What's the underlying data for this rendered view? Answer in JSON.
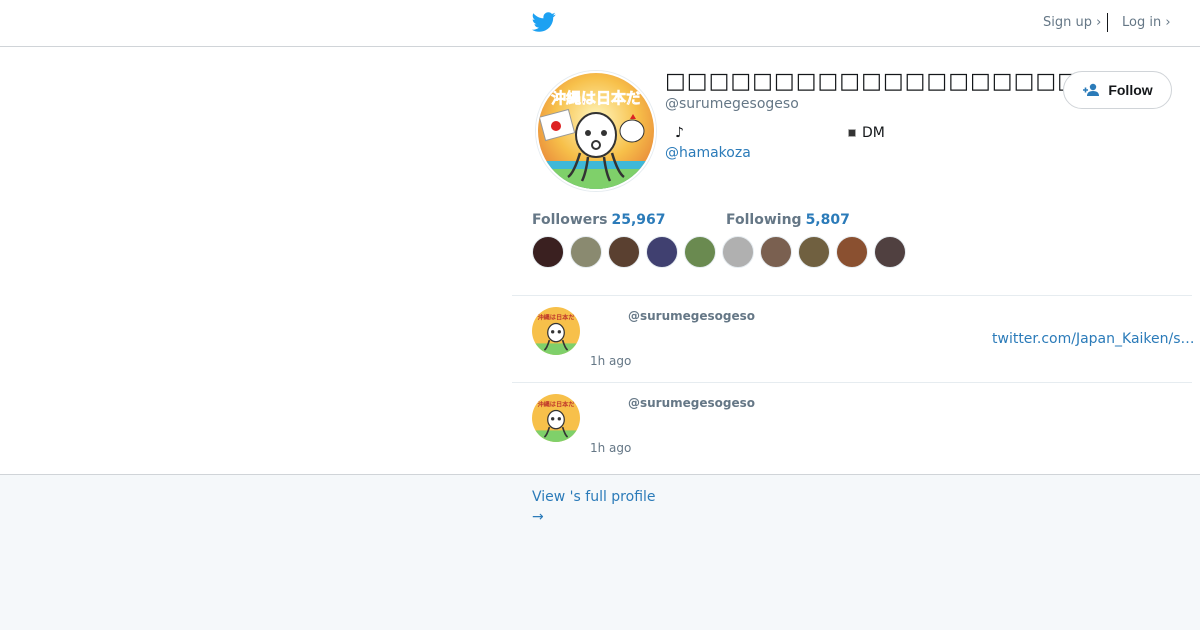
{
  "nav": {
    "signup": "Sign up ›",
    "login": "Log in ›"
  },
  "profile": {
    "name": "□□□□□□□□□□□□□□□□□□□□□",
    "handle": "@surumegesogeso",
    "bio_note": "♪",
    "bio_dm": "DM",
    "bio_link": "@hamakoza",
    "follow_label": "Follow",
    "followers_label": "Followers",
    "followers_count": "25,967",
    "following_label": "Following",
    "following_count": "5,807"
  },
  "friend_avatars": [
    "#3a2020",
    "#8a8a70",
    "#5a4030",
    "#404070",
    "#6a8a50",
    "#b0b0b0",
    "#7a6050",
    "#706040",
    "#8a5030",
    "#504040"
  ],
  "tweets": [
    {
      "handle": "@surumegesogeso",
      "link": "twitter.com/Japan_Kaiken/s…",
      "time": "1h ago"
    },
    {
      "handle": "@surumegesogeso",
      "time": "1h ago"
    }
  ],
  "footer": {
    "view_profile": "View 's full profile",
    "arrow": "→"
  },
  "colors": {
    "accent": "#2b7bb9",
    "muted": "#657786",
    "brand": "#1da1f2"
  },
  "icons": {
    "logo": "twitter-bird-icon",
    "follow": "add-person-icon"
  }
}
